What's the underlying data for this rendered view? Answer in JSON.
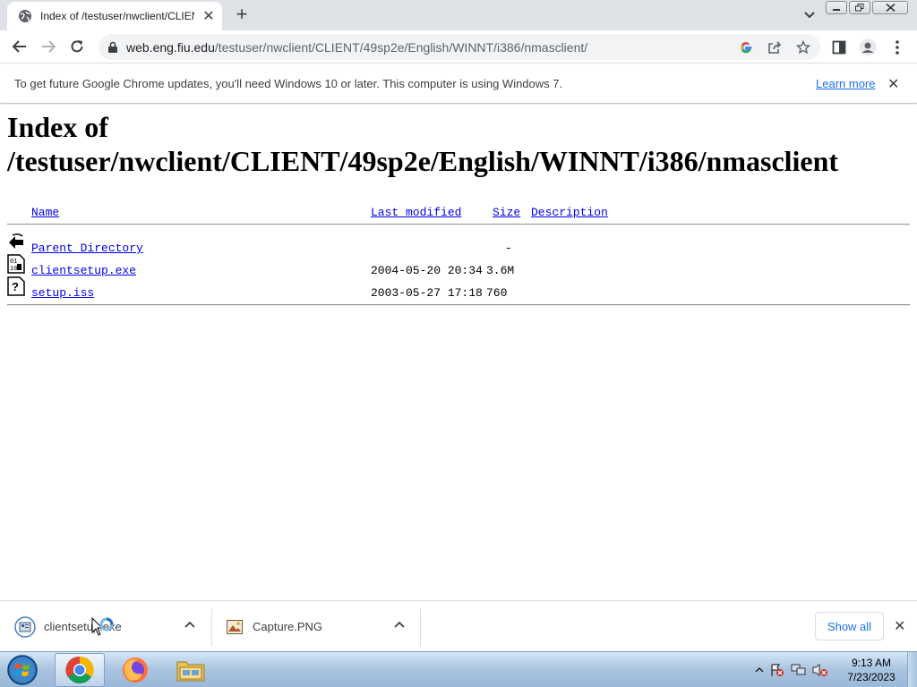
{
  "browser": {
    "tab": {
      "title": "Index of /testuser/nwclient/CLIENT/49sp2e/English/WINNT/i386/nmasclient/",
      "icon": "globe-icon"
    },
    "omnibox": {
      "url_host": "web.eng.fiu.edu",
      "url_path": "/testuser/nwclient/CLIENT/49sp2e/English/WINNT/i386/nmasclient/"
    },
    "infobar": {
      "message": "To get future Google Chrome updates, you'll need Windows 10 or later. This computer is using Windows 7.",
      "link": "Learn more"
    }
  },
  "page": {
    "heading_line1": "Index of",
    "heading_line2": "/testuser/nwclient/CLIENT/49sp2e/English/WINNT/i386/nmasclient",
    "columns": {
      "name": "Name",
      "last_modified": "Last modified",
      "size": "Size",
      "description": "Description"
    },
    "rows": [
      {
        "icon": "back-arrow-icon",
        "name": "Parent Directory",
        "modified": "",
        "size": "-"
      },
      {
        "icon": "binary-file-icon",
        "name": "clientsetup.exe",
        "modified": "2004-05-20 20:34",
        "size": "3.6M"
      },
      {
        "icon": "unknown-file-icon",
        "name": "setup.iss",
        "modified": "2003-05-27 17:18",
        "size": "760"
      }
    ]
  },
  "downloads": {
    "items": [
      {
        "name": "clientsetup.exe",
        "icon": "installer-icon"
      },
      {
        "name": "Capture.PNG",
        "icon": "image-file-icon"
      }
    ],
    "show_all": "Show all"
  },
  "taskbar": {
    "time": "9:13 AM",
    "date": "7/23/2023"
  },
  "colors": {
    "link": "#0000ee",
    "chrome_blue": "#1a73e8",
    "tabstrip": "#dee1e6"
  }
}
